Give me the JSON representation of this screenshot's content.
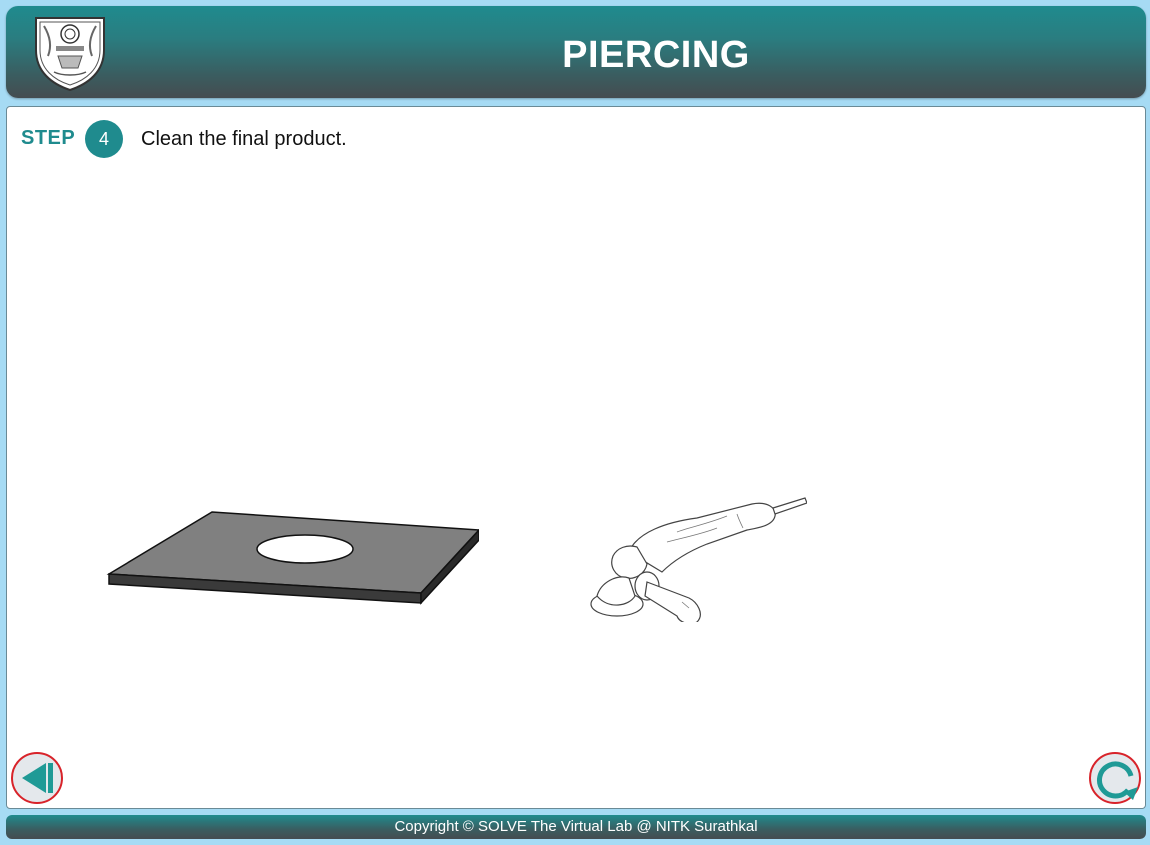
{
  "header": {
    "title": "PIERCING",
    "logo_icon": "nitk-crest-logo"
  },
  "step": {
    "label": "STEP",
    "number": "4",
    "instruction": "Clean the final product."
  },
  "scene": {
    "plate_icon": "pierced-metal-plate",
    "tool_icon": "angle-grinder"
  },
  "navigation": {
    "back_icon": "previous-icon",
    "replay_icon": "replay-icon"
  },
  "footer": {
    "copyright": "Copyright © SOLVE The Virtual Lab @ NITK Surathkal"
  },
  "colors": {
    "accent": "#1f8b8e",
    "page_background": "#a6dbf4",
    "button_ring": "#d8232a"
  }
}
